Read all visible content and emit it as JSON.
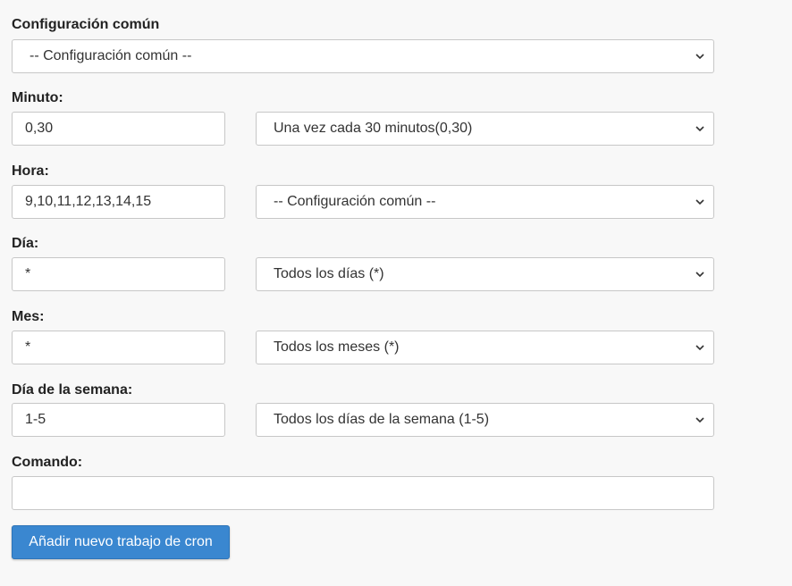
{
  "common_settings": {
    "label": "Configuración común",
    "selected": "-- Configuración común --"
  },
  "minute": {
    "label": "Minuto:",
    "value": "0,30",
    "selected": "Una vez cada 30 minutos(0,30)"
  },
  "hour": {
    "label": "Hora:",
    "value": "9,10,11,12,13,14,15",
    "selected": "-- Configuración común --"
  },
  "day": {
    "label": "Día:",
    "value": "*",
    "selected": "Todos los días (*)"
  },
  "month": {
    "label": "Mes:",
    "value": "*",
    "selected": "Todos los meses (*)"
  },
  "weekday": {
    "label": "Día de la semana:",
    "value": "1-5",
    "selected": "Todos los días de la semana (1-5)"
  },
  "command": {
    "label": "Comando:",
    "value": ""
  },
  "submit_label": "Añadir nuevo trabajo de cron",
  "colors": {
    "button": "#3a87d0",
    "background": "#f8f8f8"
  }
}
